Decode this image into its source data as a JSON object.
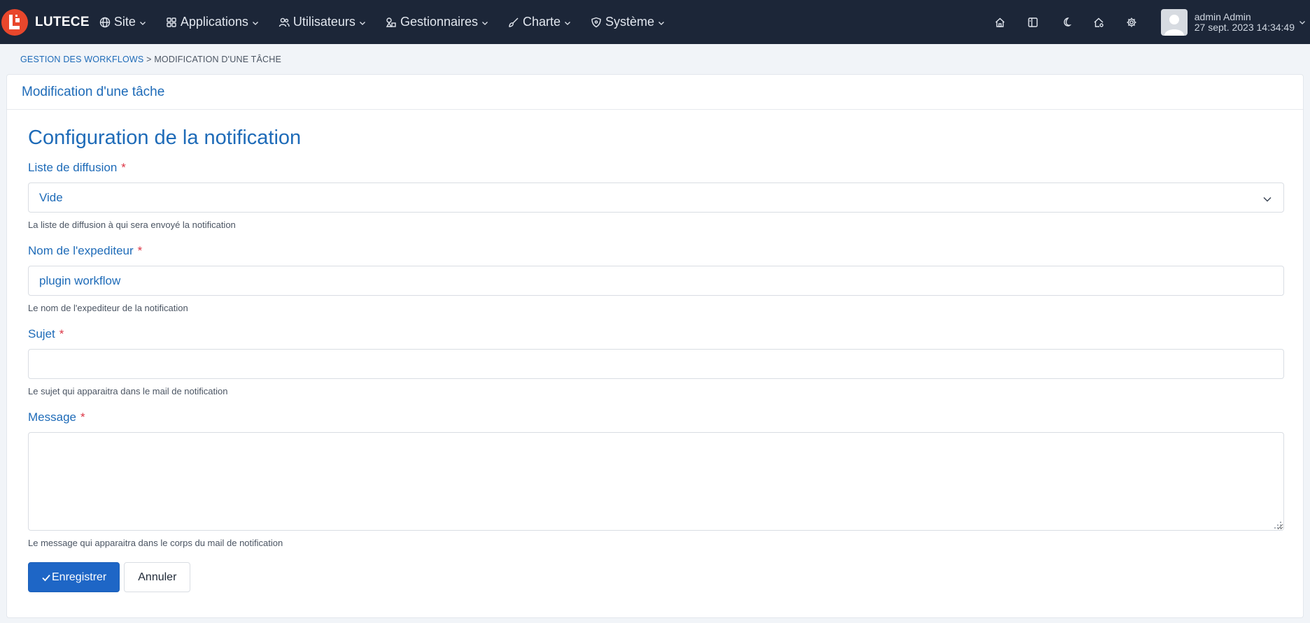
{
  "navbar": {
    "brand": "LUTECE",
    "menu": [
      {
        "label": "Site",
        "icon": "globe-icon"
      },
      {
        "label": "Applications",
        "icon": "apps-icon"
      },
      {
        "label": "Utilisateurs",
        "icon": "users-icon"
      },
      {
        "label": "Gestionnaires",
        "icon": "shapes-icon"
      },
      {
        "label": "Charte",
        "icon": "brush-icon"
      },
      {
        "label": "Système",
        "icon": "shield-icon"
      }
    ],
    "tools": [
      "home-icon",
      "layout-icon",
      "moon-icon",
      "home-gear-icon",
      "gear-icon"
    ],
    "user": {
      "name": "admin Admin",
      "date": "27 sept. 2023 14:34:49"
    }
  },
  "breadcrumb": {
    "parent": "Gestion des workflows",
    "separator": ">",
    "current": "Modification d'une tâche"
  },
  "card": {
    "title": "Modification d'une tâche"
  },
  "form": {
    "section_title": "Configuration de la notification",
    "required_mark": "*",
    "fields": {
      "mailing_list": {
        "label": "Liste de diffusion",
        "value": "Vide",
        "help": "La liste de diffusion à qui sera envoyé la notification"
      },
      "sender_name": {
        "label": "Nom de l'expediteur",
        "value": "plugin workflow",
        "help": "Le nom de l'expediteur de la notification"
      },
      "subject": {
        "label": "Sujet",
        "value": "",
        "help": "Le sujet qui apparaitra dans le mail de notification"
      },
      "message": {
        "label": "Message",
        "value": "",
        "help": "Le message qui apparaitra dans le corps du mail de notification"
      }
    },
    "buttons": {
      "save": "Enregistrer",
      "cancel": "Annuler"
    }
  },
  "colors": {
    "navbar_bg": "#1c2638",
    "brand_logo": "#e8472c",
    "accent": "#1e6bb8",
    "primary_button": "#1e66c6",
    "required": "#dc3545"
  }
}
